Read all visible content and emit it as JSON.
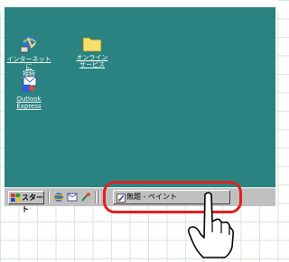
{
  "desktop": {
    "background_color": "#2a8380",
    "icons": [
      {
        "name": "internet-connect",
        "label": "インターネットに\n接続"
      },
      {
        "name": "online-services",
        "label": "オンライン\nサービス"
      },
      {
        "name": "outlook-express",
        "label": "Outlook\nExpress"
      }
    ]
  },
  "taskbar": {
    "start_label": "スタート",
    "quick_launch": [
      "internet-explorer-icon",
      "outlook-icon",
      "channels-icon"
    ],
    "tasks": [
      {
        "label": "無題 - ペイント",
        "icon": "paint-icon"
      }
    ]
  },
  "annotation": {
    "color": "#e0201f"
  }
}
